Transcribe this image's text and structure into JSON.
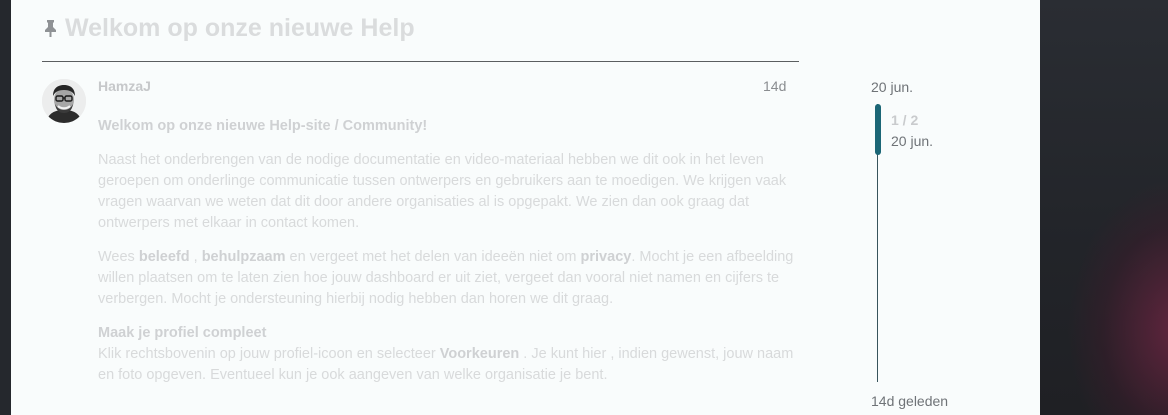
{
  "topic": {
    "title": "Welkom op onze nieuwe Help"
  },
  "post": {
    "username": "HamzaJ",
    "age": "14d",
    "intro": "Welkom op onze nieuwe Help-site / Community!",
    "paragraph1": "Naast het onderbrengen van de nodige documentatie en video-materiaal hebben we dit ook in het leven geroepen om onderlinge communicatie tussen ontwerpers en gebruikers aan te moedigen. We krijgen vaak vragen waarvan we weten dat dit door andere organisaties al is opgepakt. We zien dan ook graag dat ontwerpers met elkaar in contact komen.",
    "p2": {
      "t1": "Wees ",
      "b1": "beleefd",
      "t2": " , ",
      "b2": "behulpzaam",
      "t3": " en vergeet met het delen van ideeën niet om ",
      "b3": "privacy",
      "t4": ". Mocht je een afbeelding willen plaatsen om te laten zien hoe jouw dashboard er uit ziet, vergeet dan vooral niet namen en cijfers te verbergen. Mocht je ondersteuning hierbij nodig hebben dan horen we dit graag."
    },
    "p3": {
      "heading": "Maak je profiel compleet",
      "t1": "Klik rechtsbovenin op jouw profiel-icoon en selecteer ",
      "b1": "Voorkeuren",
      "t2": " . Je kunt hier , indien gewenst, jouw naam en foto opgeven. Eventueel kun je ook aangeven van welke organisatie je bent."
    }
  },
  "timeline": {
    "start_date": "20 jun.",
    "counter": "1 / 2",
    "current_date": "20 jun.",
    "end_label": "14d geleden",
    "accent_color": "#1b6676"
  },
  "icons": {
    "pin": "pin-icon",
    "avatar": "avatar"
  }
}
